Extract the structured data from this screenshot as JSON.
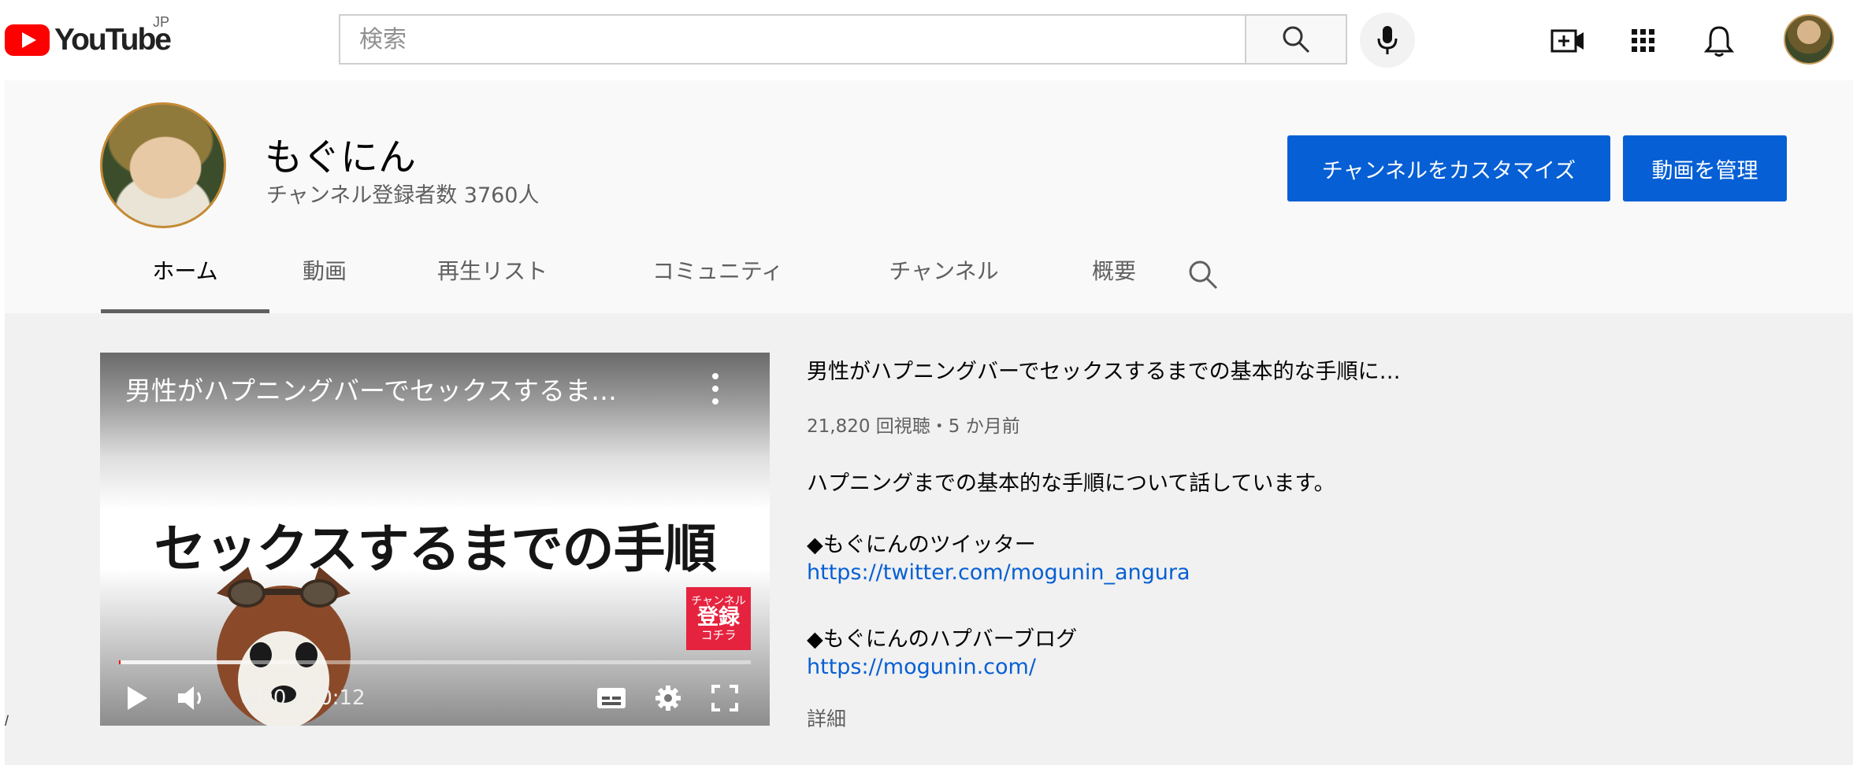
{
  "masthead": {
    "logo_text": "YouTube",
    "region": "JP",
    "search_placeholder": "検索",
    "search_value": "",
    "icons": [
      "search-icon",
      "mic-icon",
      "create-video-icon",
      "apps-grid-icon",
      "notifications-bell-icon",
      "account-avatar"
    ]
  },
  "channel": {
    "name": "もぐにん",
    "subscribers": "チャンネル登録者数 3760人",
    "customize_label": "チャンネルをカスタマイズ",
    "manage_label": "動画を管理"
  },
  "tabs": [
    {
      "label": "ホーム",
      "active": true
    },
    {
      "label": "動画",
      "active": false
    },
    {
      "label": "再生リスト",
      "active": false
    },
    {
      "label": "コミュニティ",
      "active": false
    },
    {
      "label": "チャンネル",
      "active": false
    },
    {
      "label": "概要",
      "active": false
    }
  ],
  "player": {
    "overlay_title": "男性がハプニングバーでセックスするま…",
    "thumbnail_text": "セックスするまでの手順",
    "badge_line1": "チャンネル",
    "badge_line2": "登録",
    "badge_line3": "コチラ",
    "time": "0:00 / 10:12",
    "played_fraction": 0.0,
    "buffered_fraction": 0.195
  },
  "video": {
    "title": "男性がハプニングバーでセックスするまでの基本的な手順に…",
    "meta": "21,820 回視聴・5 か月前",
    "desc_line1": "ハプニングまでの基本的な手順について話しています。",
    "twitter_heading": "◆もぐにんのツイッター",
    "twitter_url": "https://twitter.com/mogunin_angura",
    "blog_heading": "◆もぐにんのハプバーブログ",
    "blog_url": "https://mogunin.com/",
    "more_label": "詳細"
  },
  "colors": {
    "brand_red": "#ff0000",
    "button_blue": "#065fd4",
    "link_blue": "#065fd4",
    "badge_red": "#e5233f"
  }
}
